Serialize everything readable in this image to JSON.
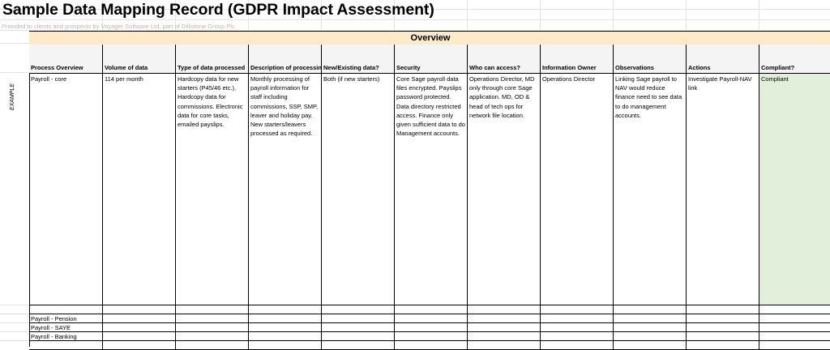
{
  "title": "Sample Data Mapping Record (GDPR Impact Assessment)",
  "subtitle": "Provided to clients and prospects by Voyager Software Ltd, part of Dillistone Group Plc.",
  "section_header": "Overview",
  "row_tag": "EXAMPLE",
  "columns": [
    "Process Overview",
    "Volume of data",
    "Type of data processed",
    "Description of processing",
    "New/Existing data?",
    "Security",
    "Who can access?",
    "Information Owner",
    "Observations",
    "Actions",
    "Compliant?"
  ],
  "example_row": {
    "process": "Payroll - core",
    "volume": "114 per month",
    "type": "Hardcopy data for new starters (P45/46 etc.), Hardcopy data for commissions. Electronic data for core tasks, emailed payslips.",
    "description": "Monthly processing of payroll information for staff including commissions, SSP, SMP, leaver and holiday pay. New starters/leavers processed as required.",
    "new_existing": "Both (if new starters)",
    "security": "Core Sage payroll data files encrypted. Payslips password protected. Data directory restricted access. Finance only given sufficient data to do Management accounts.",
    "access": "Operations Director, MD only through core Sage application. MD, OD & head of tech ops for network file location.",
    "owner": "Operations Director",
    "observations": "Linking Sage payroll to NAV would reduce finance need to see data to do management accounts.",
    "actions": "Investigate Payroll-NAV link",
    "compliant": "Compliant"
  },
  "other_rows": [
    "",
    "Payroll - Pension",
    "Payroll - SAYE",
    "Payroll - Banking",
    ""
  ],
  "colors": {
    "overview_band": "#fdebc8",
    "compliant_fill": "#e2efda"
  }
}
